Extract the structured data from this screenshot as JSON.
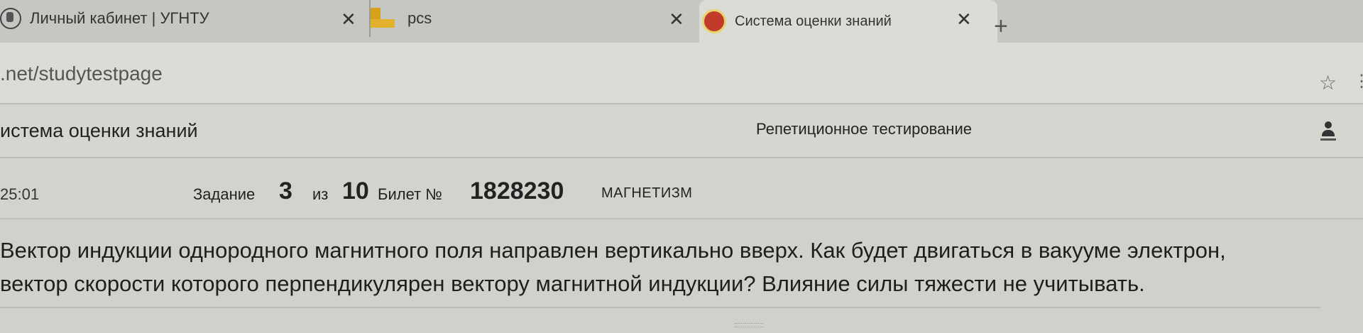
{
  "browser": {
    "tabs": [
      {
        "title": "Личный кабинет | УГНТУ",
        "icon": "site-emblem-icon",
        "active": false
      },
      {
        "title": "pcs",
        "icon": "folder-icon",
        "active": false
      },
      {
        "title": "Система оценки знаний",
        "icon": "university-emblem-icon",
        "active": true
      }
    ],
    "close_glyph": "✕",
    "new_tab_glyph": "+",
    "url": ".net/studytestpage",
    "star_glyph": "☆",
    "ext_glyph": "⋮"
  },
  "header": {
    "site_title": "истема оценки знаний",
    "mode_title": "Репетиционное тестирование"
  },
  "task": {
    "timer": "25:01",
    "task_label": "Задание",
    "task_number": "3",
    "of_label": "из",
    "total": "10",
    "ticket_label": "Билет №",
    "ticket_number": "1828230",
    "topic": "МАГНЕТИЗМ"
  },
  "question": {
    "line1": "Вектор индукции однородного магнитного поля направлен вертикально вверх. Как будет двигаться в вакууме электрон,",
    "line2": "вектор скорости которого перпендикулярен вектору магнитной индукции? Влияние силы тяжести не учитывать."
  }
}
